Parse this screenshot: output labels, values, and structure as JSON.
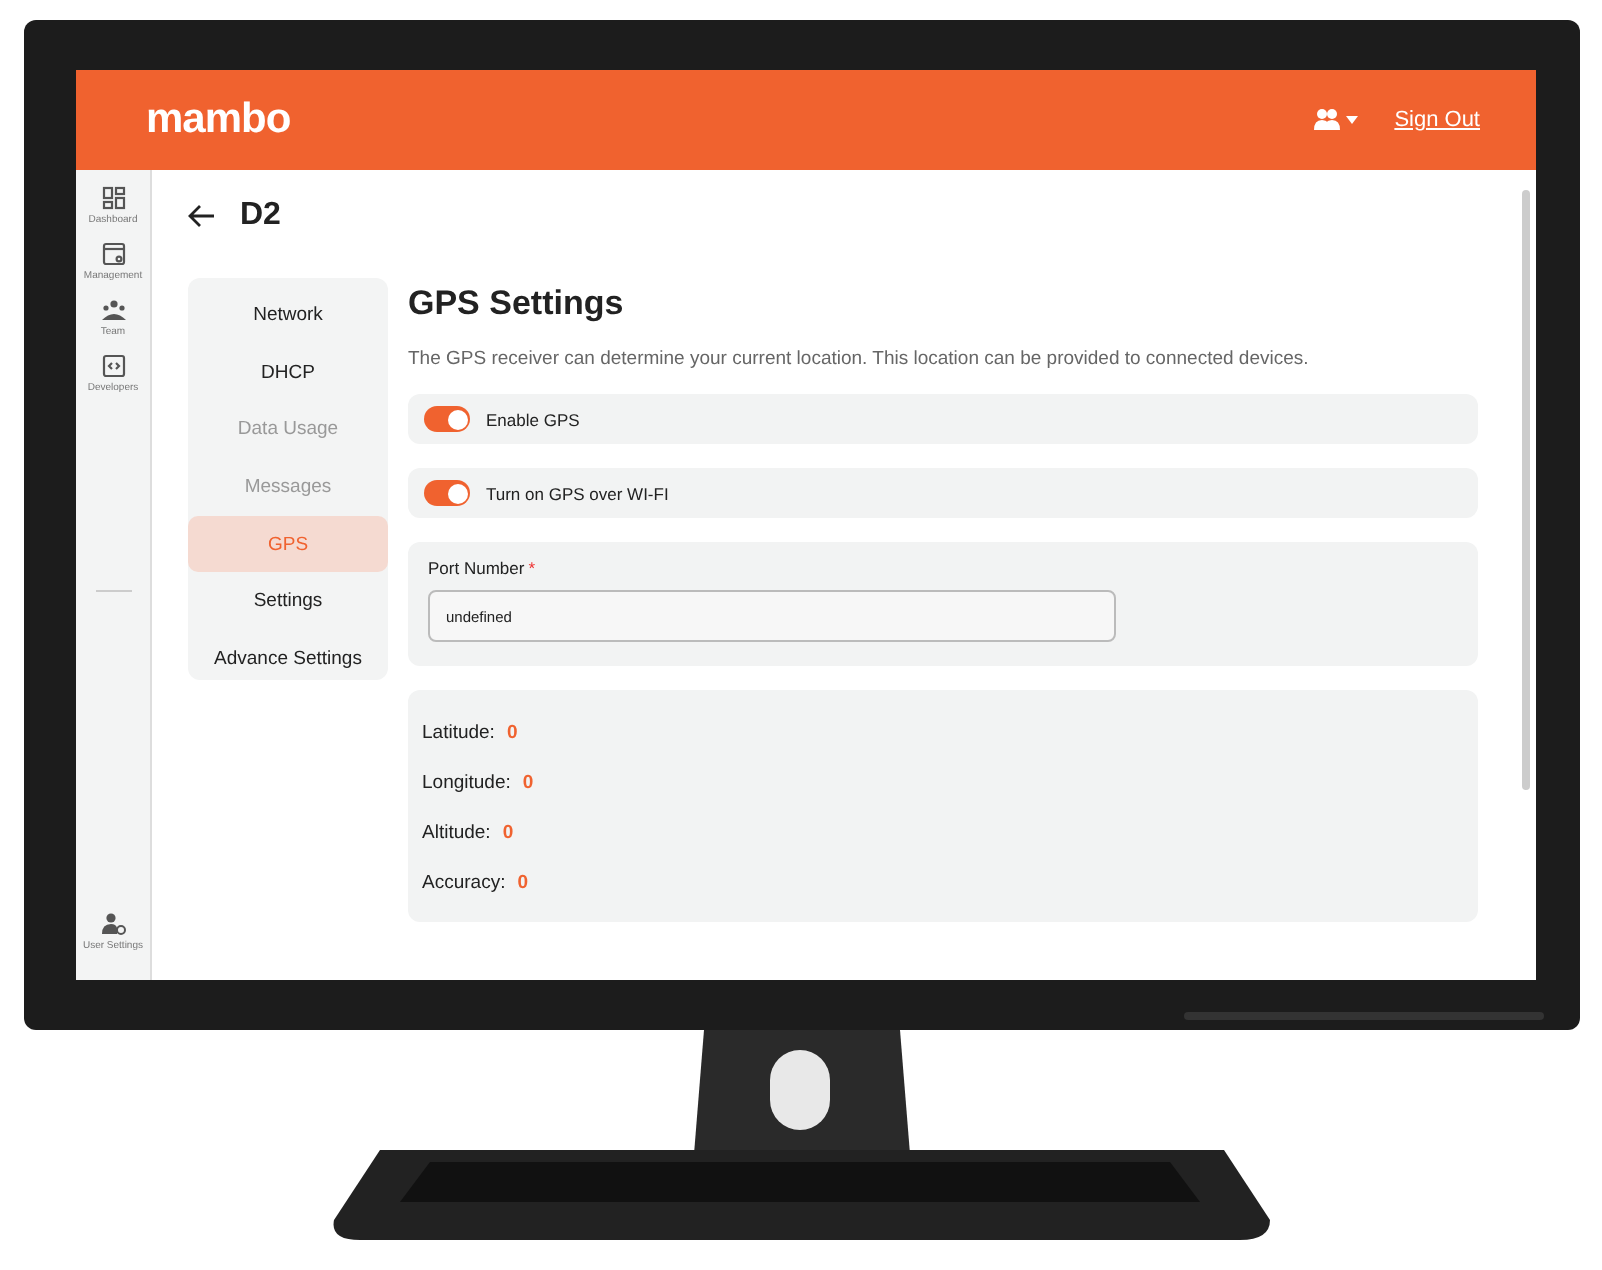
{
  "header": {
    "logo": "mambo",
    "sign_out": "Sign Out"
  },
  "rail": [
    {
      "label": "Dashboard"
    },
    {
      "label": "Management"
    },
    {
      "label": "Team"
    },
    {
      "label": "Developers"
    }
  ],
  "rail_bottom": {
    "label": "User Settings"
  },
  "page_title": "D2",
  "nav": [
    {
      "label": "Network",
      "selected": false,
      "disabled": false
    },
    {
      "label": "DHCP",
      "selected": false,
      "disabled": false
    },
    {
      "label": "Data Usage",
      "selected": false,
      "disabled": true
    },
    {
      "label": "Messages",
      "selected": false,
      "disabled": true
    },
    {
      "label": "GPS",
      "selected": true,
      "disabled": false
    },
    {
      "label": "Settings",
      "selected": false,
      "disabled": false
    },
    {
      "label": "Advance Settings",
      "selected": false,
      "disabled": false
    }
  ],
  "section": {
    "title": "GPS Settings",
    "description": "The GPS receiver can determine your current location. This location can be provided to connected devices."
  },
  "toggles": [
    {
      "label": "Enable GPS",
      "on": true
    },
    {
      "label": "Turn on GPS over WI-FI",
      "on": true
    }
  ],
  "port": {
    "label": "Port Number",
    "required_mark": "*",
    "value": "undefined"
  },
  "readings": [
    {
      "label": "Latitude:",
      "value": "0"
    },
    {
      "label": "Longitude:",
      "value": "0"
    },
    {
      "label": "Altitude:",
      "value": "0"
    },
    {
      "label": "Accuracy:",
      "value": "0"
    }
  ]
}
